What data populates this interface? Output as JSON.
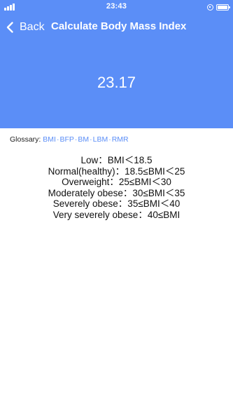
{
  "status_bar": {
    "time": "23:43"
  },
  "nav": {
    "back_label": "Back",
    "title": "Calculate Body Mass Index"
  },
  "result": {
    "bmi": "23.17"
  },
  "glossary": {
    "label": "Glossary:",
    "links": [
      "BMI",
      "BFP",
      "BM",
      "LBM",
      "RMR"
    ],
    "separator": "·"
  },
  "categories": [
    "Low：BMI＜18.5",
    "Normal(healthy)：18.5≤BMI＜25",
    "Overweight：25≤BMI＜30",
    "Moderately obese：30≤BMI＜35",
    "Severely obese：35≤BMI＜40",
    "Very severely obese：40≤BMI"
  ],
  "colors": {
    "accent": "#5b8ef7",
    "text": "#111111",
    "background": "#ffffff"
  },
  "icons": {
    "signal": "signal-icon",
    "rotation_lock": "rotation-lock-icon",
    "battery": "battery-icon",
    "back": "chevron-left-icon"
  }
}
